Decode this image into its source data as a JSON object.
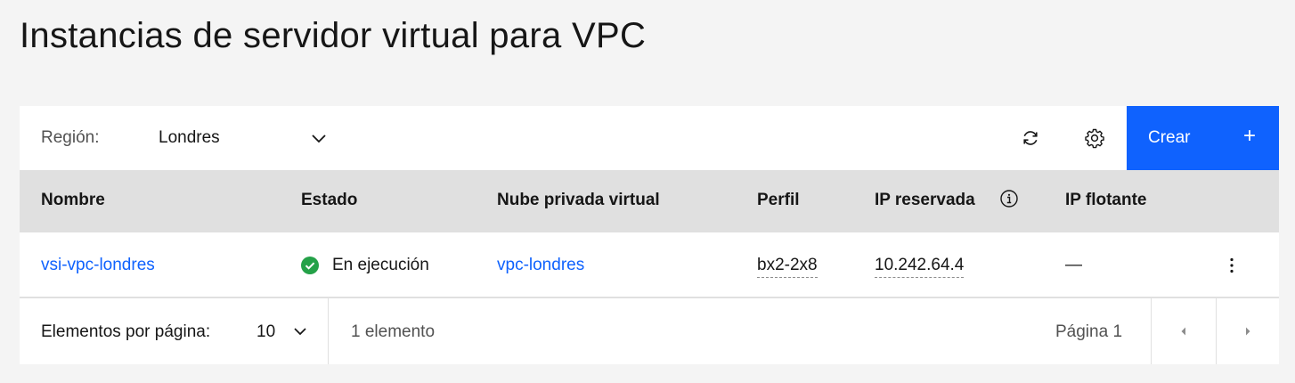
{
  "page": {
    "title": "Instancias de servidor virtual para VPC"
  },
  "toolbar": {
    "region_label": "Región:",
    "region_value": "Londres",
    "create_label": "Crear",
    "create_icon": "+"
  },
  "table": {
    "headers": {
      "name": "Nombre",
      "status": "Estado",
      "vpc": "Nube privada virtual",
      "profile": "Perfil",
      "reserved_ip": "IP reservada",
      "floating_ip": "IP flotante"
    },
    "rows": [
      {
        "name": "vsi-vpc-londres",
        "status": "En ejecución",
        "vpc": "vpc-londres",
        "profile": "bx2-2x8",
        "reserved_ip": "10.242.64.4",
        "floating_ip": "—"
      }
    ]
  },
  "pagination": {
    "per_page_label": "Elementos por página:",
    "per_page_value": "10",
    "item_count": "1 elemento",
    "page_label": "Página 1"
  },
  "colors": {
    "primary": "#0f62fe",
    "success": "#24a148",
    "header_bg": "#e0e0e0",
    "page_bg": "#f4f4f4"
  }
}
